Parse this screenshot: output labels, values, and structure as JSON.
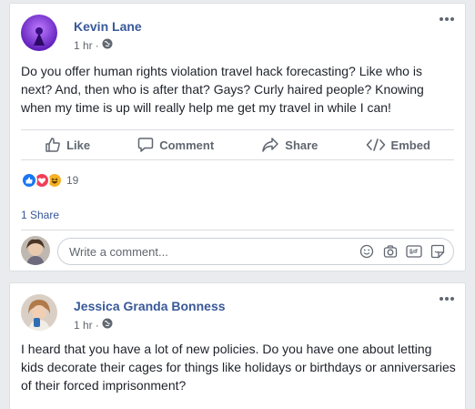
{
  "posts": [
    {
      "author": "Kevin Lane",
      "time": "1 hr",
      "dot": "·",
      "text": "Do you offer human rights violation travel hack forecasting? Like who is next? And, then who is after that? Gays? Curly haired people? Knowing when my time is up will really help me get my travel in while I can!",
      "actions": {
        "like": "Like",
        "comment": "Comment",
        "share": "Share",
        "embed": "Embed"
      },
      "reaction_count": "19",
      "shares": "1 Share",
      "comment_placeholder": "Write a comment..."
    },
    {
      "author": "Jessica Granda Bonness",
      "time": "1 hr",
      "dot": "·",
      "text": "I heard that you have a lot of new policies. Do you have one about letting kids decorate their cages for things like holidays or birthdays or anniversaries of their forced imprisonment?"
    }
  ],
  "colors": {
    "link": "#385898",
    "muted": "#606770",
    "like_blue": "#1877f2",
    "love_red": "#f33e58",
    "haha_yellow": "#f7b125"
  },
  "icons": [
    "globe-icon",
    "more-options-icon",
    "like-icon",
    "comment-icon",
    "share-icon",
    "embed-icon",
    "emoji-icon",
    "camera-icon",
    "gif-icon",
    "sticker-icon"
  ]
}
